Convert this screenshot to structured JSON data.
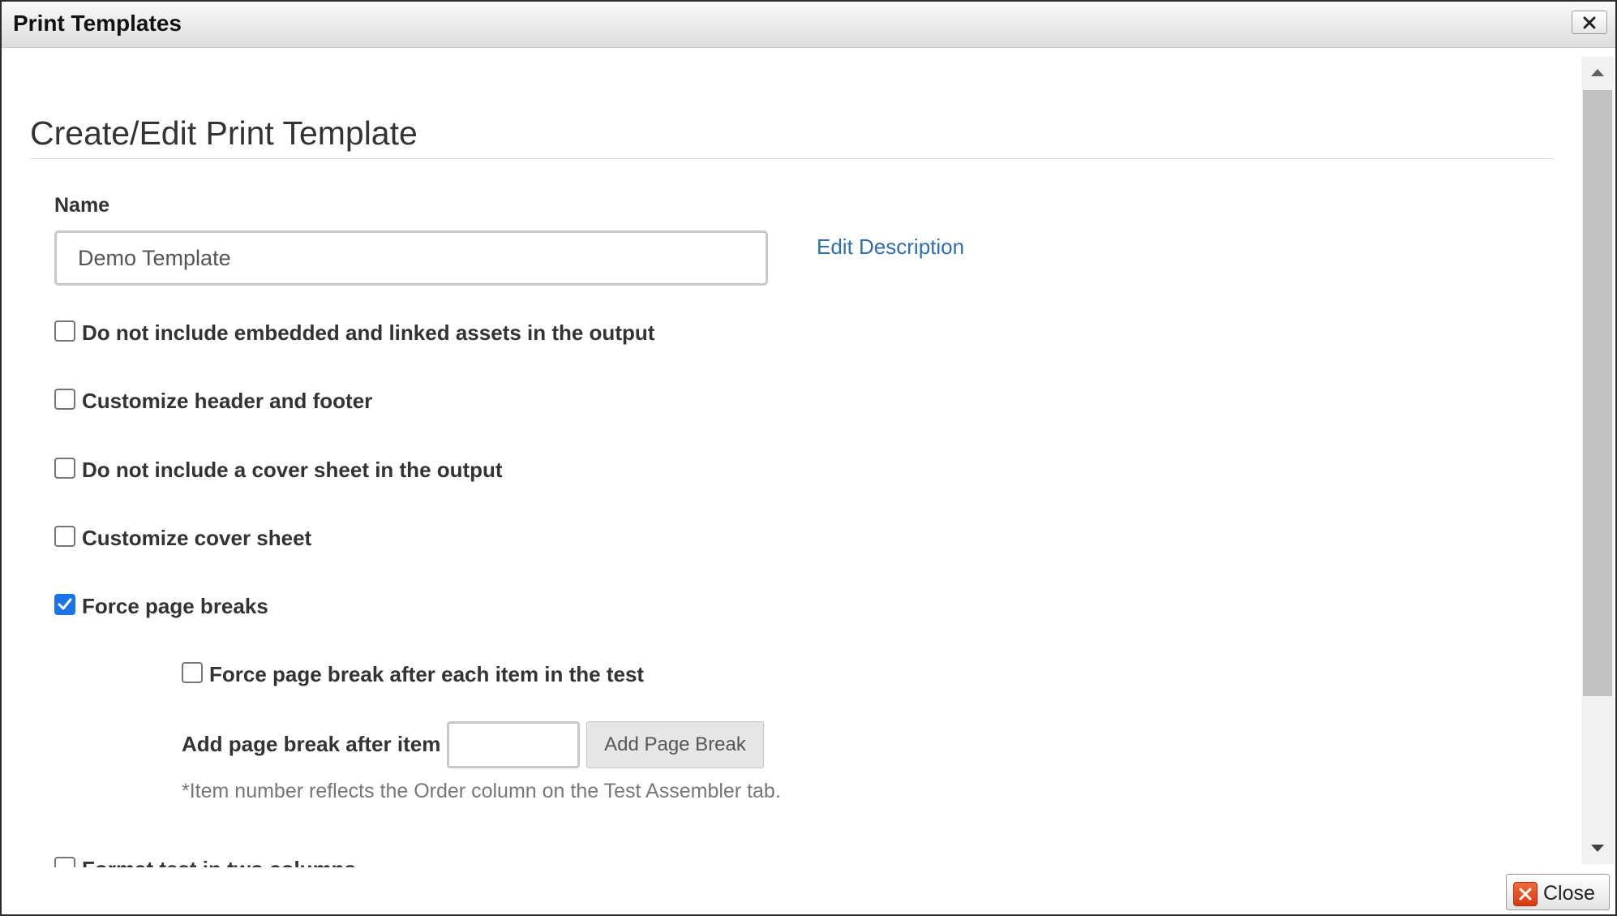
{
  "dialog": {
    "title": "Print Templates"
  },
  "form": {
    "heading": "Create/Edit Print Template",
    "name_label": "Name",
    "name_value": "Demo Template",
    "edit_description_link": "Edit Description",
    "options": [
      {
        "label": "Do not include embedded and linked assets in the output",
        "checked": false
      },
      {
        "label": "Customize header and footer",
        "checked": false
      },
      {
        "label": "Do not include a cover sheet in the output",
        "checked": false
      },
      {
        "label": "Customize cover sheet",
        "checked": false
      },
      {
        "label": "Force page breaks",
        "checked": true
      },
      {
        "label": "Force page break after each item in the test",
        "checked": false
      },
      {
        "label": "Format test in two columns",
        "checked": false
      }
    ],
    "page_break": {
      "label": "Add page break after item",
      "value": "",
      "button_label": "Add Page Break",
      "note": "*Item number reflects the Order column on the Test Assembler tab."
    }
  },
  "footer": {
    "close_label": "Close"
  }
}
